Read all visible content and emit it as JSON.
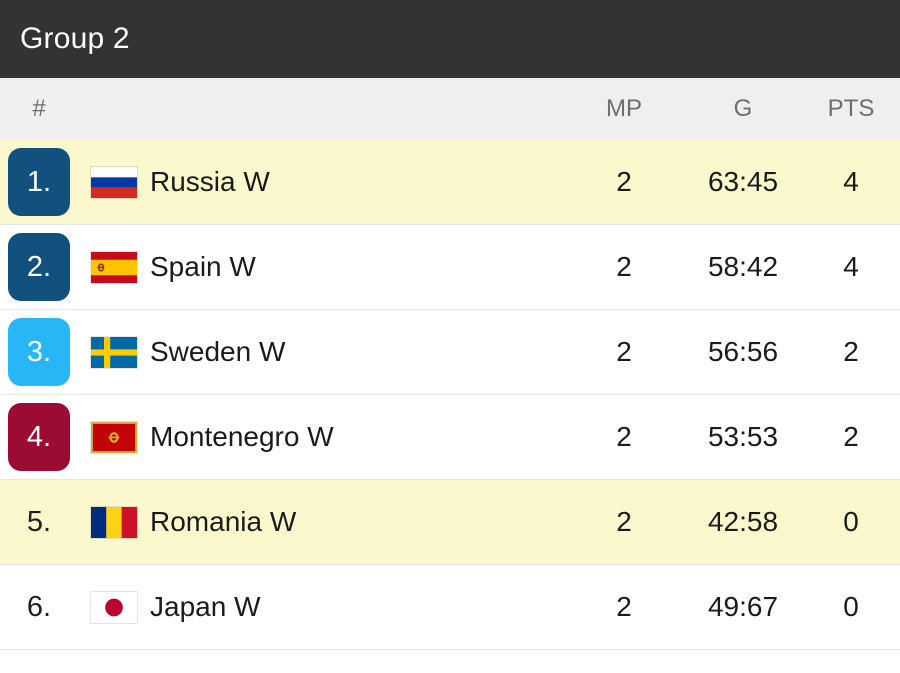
{
  "header": {
    "title": "Group 2",
    "background": "#333333",
    "text_color": "#ffffff"
  },
  "columns": {
    "rank": "#",
    "team": "",
    "mp": "MP",
    "g": "G",
    "pts": "PTS"
  },
  "colors": {
    "highlight_row": "#fcf8ce",
    "badge_qualified": "#12507e",
    "badge_playoff": "#29b6f6",
    "badge_relegation": "#9b0b33",
    "row_divider": "#e6e6e6",
    "header_band": "#efefef",
    "header_label": "#6e6e6e"
  },
  "rows": [
    {
      "rank": "1.",
      "team": "Russia W",
      "mp": "2",
      "g": "63:45",
      "pts": "4",
      "badge": "#12507e",
      "highlight": true,
      "flag": "russia"
    },
    {
      "rank": "2.",
      "team": "Spain W",
      "mp": "2",
      "g": "58:42",
      "pts": "4",
      "badge": "#12507e",
      "highlight": false,
      "flag": "spain"
    },
    {
      "rank": "3.",
      "team": "Sweden W",
      "mp": "2",
      "g": "56:56",
      "pts": "2",
      "badge": "#29b6f6",
      "highlight": false,
      "flag": "sweden"
    },
    {
      "rank": "4.",
      "team": "Montenegro W",
      "mp": "2",
      "g": "53:53",
      "pts": "2",
      "badge": "#9b0b33",
      "highlight": false,
      "flag": "montenegro"
    },
    {
      "rank": "5.",
      "team": "Romania W",
      "mp": "2",
      "g": "42:58",
      "pts": "0",
      "badge": null,
      "highlight": true,
      "flag": "romania"
    },
    {
      "rank": "6.",
      "team": "Japan W",
      "mp": "2",
      "g": "49:67",
      "pts": "0",
      "badge": null,
      "highlight": false,
      "flag": "japan"
    }
  ]
}
